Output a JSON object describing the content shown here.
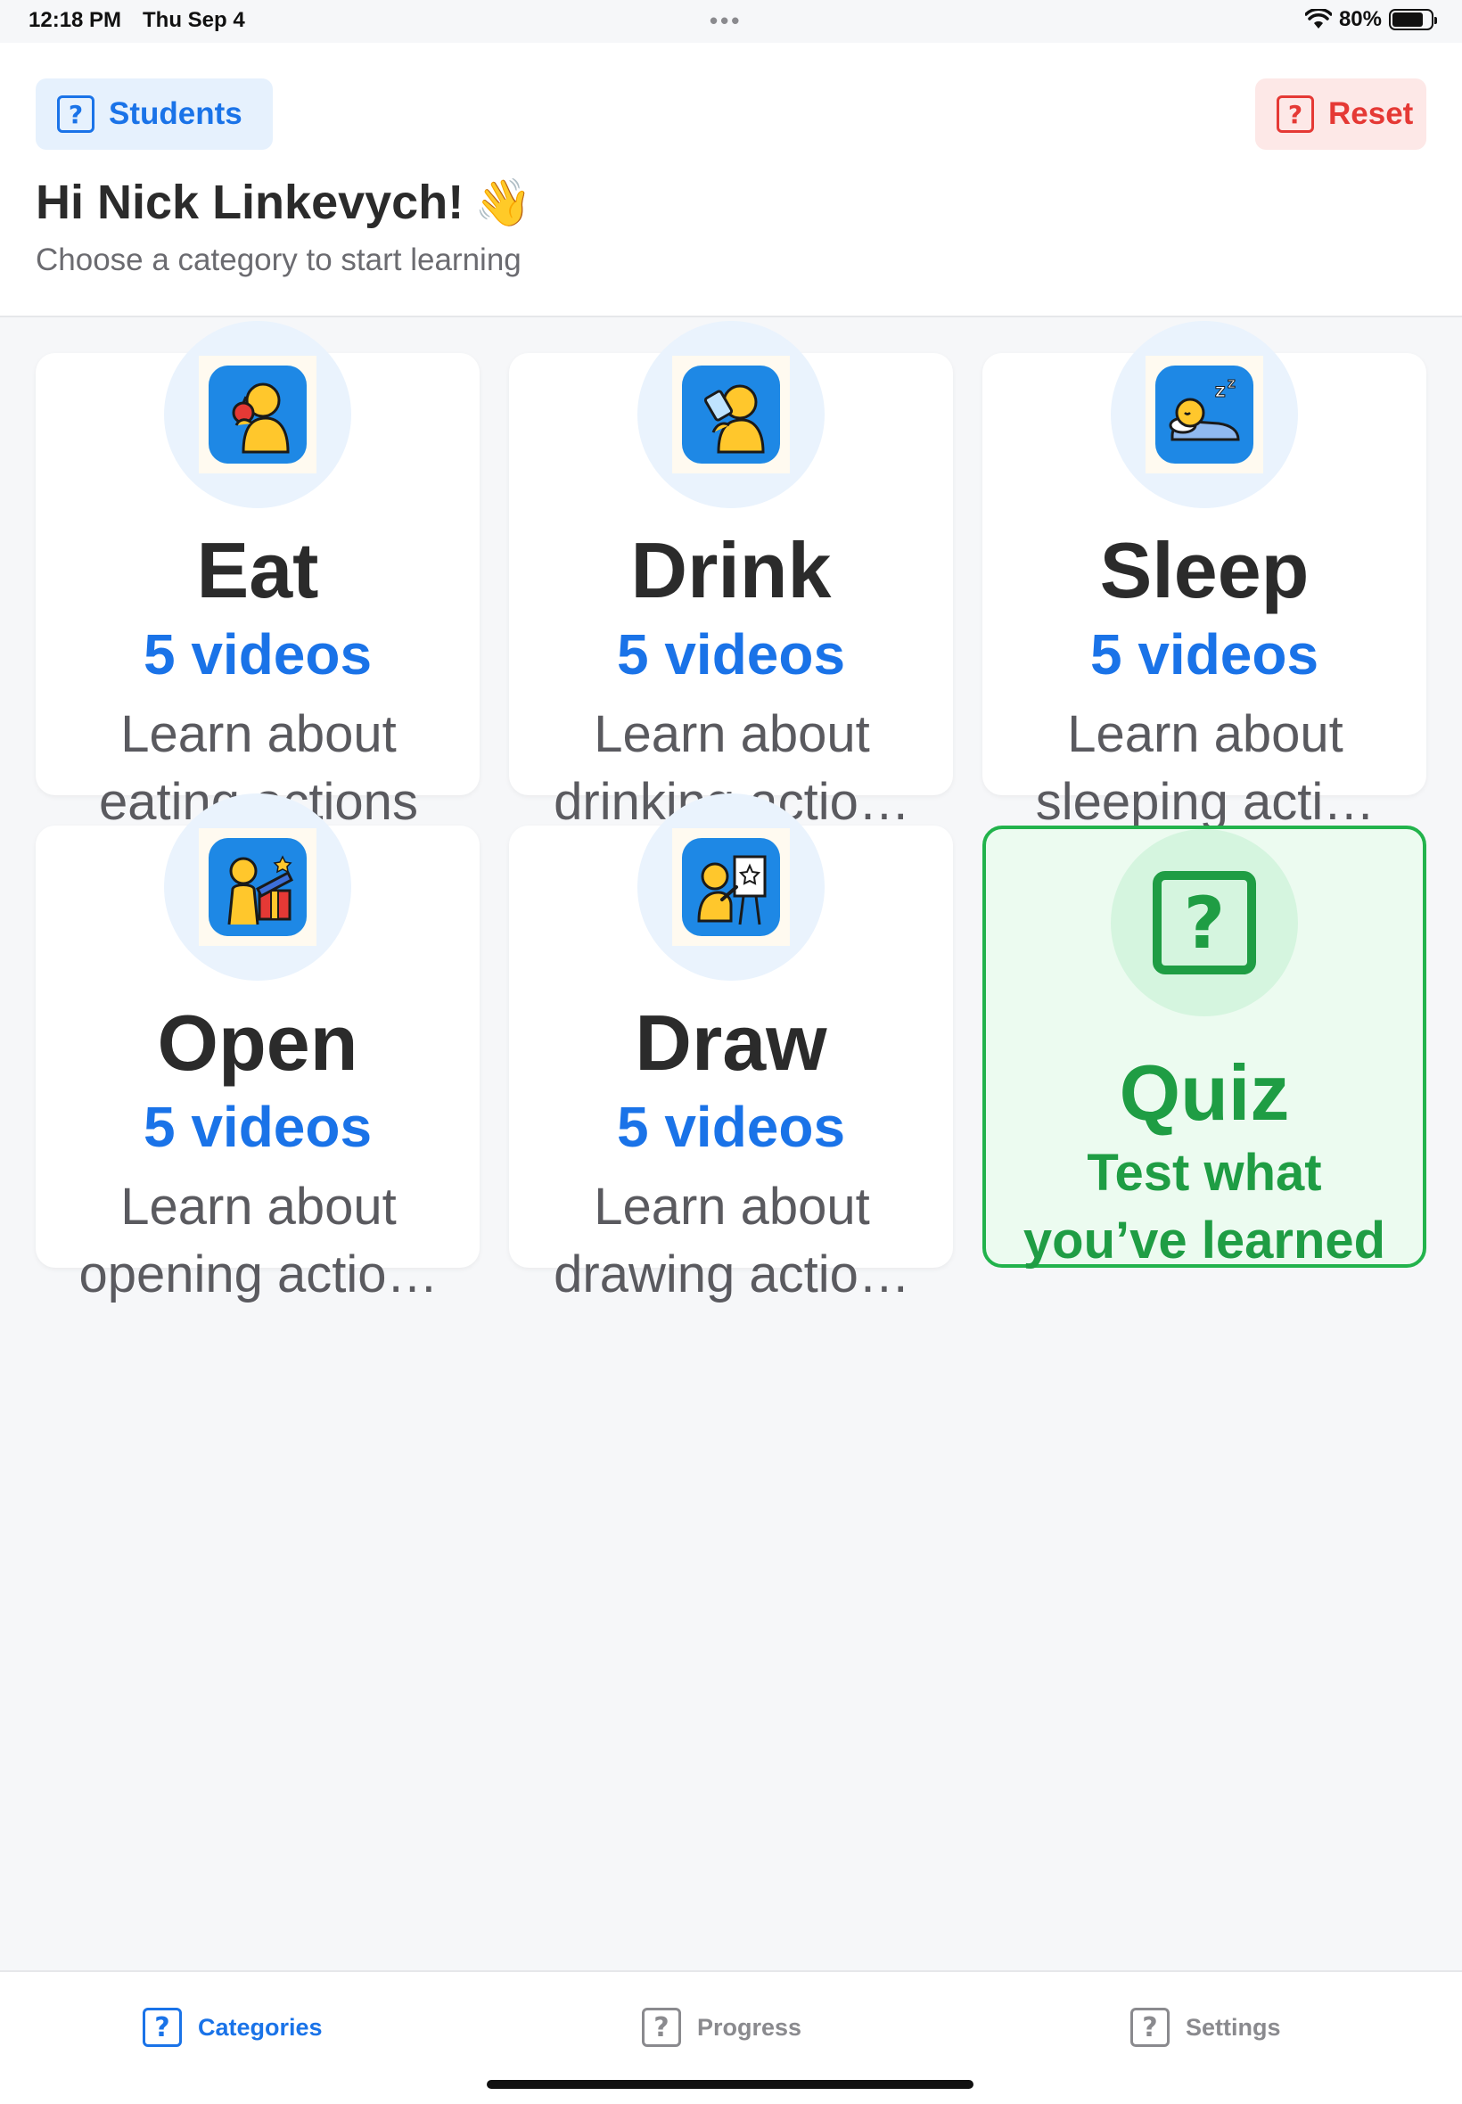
{
  "status_bar": {
    "time": "12:18 PM",
    "date": "Thu Sep 4",
    "dots": "•••",
    "battery_percent": "80%",
    "battery_level": 0.8,
    "wifi_icon": "wifi-icon"
  },
  "header": {
    "students_button": {
      "label": "Students",
      "icon": "question-square-icon",
      "color": "#1a73e8"
    },
    "reset_button": {
      "label": "Reset",
      "icon": "question-square-icon",
      "color": "#e53935"
    },
    "greeting": "Hi Nick Linkevych!",
    "greeting_emoji": "👋",
    "subtitle": "Choose a category to start learning"
  },
  "categories": [
    {
      "title": "Eat",
      "count": "5 videos",
      "desc_line1": "Learn about",
      "desc_line2": "eating actions",
      "icon": "person-eating-icon"
    },
    {
      "title": "Drink",
      "count": "5 videos",
      "desc_line1": "Learn about",
      "desc_line2": "drinking actio…",
      "icon": "person-drinking-icon"
    },
    {
      "title": "Sleep",
      "count": "5 videos",
      "desc_line1": "Learn about",
      "desc_line2": "sleeping acti…",
      "icon": "person-sleeping-icon"
    },
    {
      "title": "Open",
      "count": "5 videos",
      "desc_line1": "Learn about",
      "desc_line2": "opening actio…",
      "icon": "person-opening-gift-icon"
    },
    {
      "title": "Draw",
      "count": "5 videos",
      "desc_line1": "Learn about",
      "desc_line2": "drawing actio…",
      "icon": "person-drawing-icon"
    }
  ],
  "quiz": {
    "title": "Quiz",
    "subtitle_line1": "Test what",
    "subtitle_line2": "you’ve learned",
    "icon": "question-square-icon",
    "color": "#1f9d44"
  },
  "tab_bar": {
    "tabs": [
      {
        "label": "Categories",
        "icon": "question-square-icon",
        "active": true
      },
      {
        "label": "Progress",
        "icon": "question-square-icon",
        "active": false
      },
      {
        "label": "Settings",
        "icon": "question-square-icon",
        "active": false
      }
    ]
  }
}
